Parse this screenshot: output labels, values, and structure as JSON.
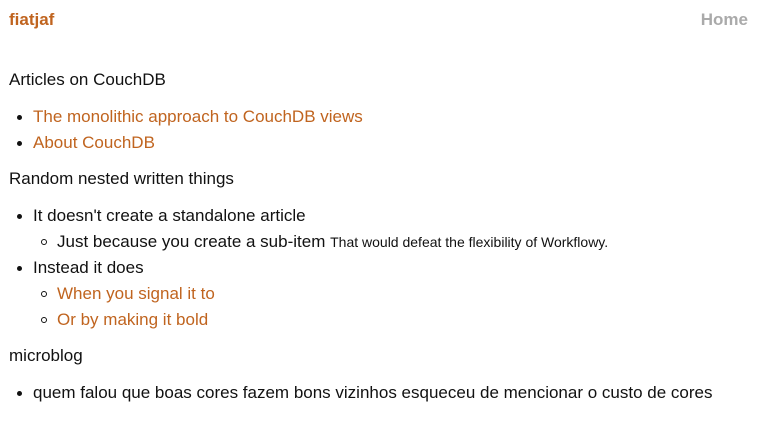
{
  "header": {
    "brand": "fiatjaf",
    "home": "Home"
  },
  "sections": {
    "couchdb": {
      "title": "Articles on CouchDB",
      "items": [
        "The monolithic approach to CouchDB views",
        "About CouchDB"
      ]
    },
    "nested": {
      "title": "Random nested written things",
      "item1": "It doesn't create a standalone article",
      "item1_sub": "Just because you create a sub-item",
      "item1_sub_note": "That would defeat the flexibility of Workflowy.",
      "item2": "Instead it does",
      "item2_subs": [
        "When you signal it to",
        "Or by making it bold"
      ]
    },
    "microblog": {
      "title": "microblog",
      "first_item": "quem falou que boas cores fazem bons vizinhos esqueceu de mencionar o custo de cores"
    }
  },
  "colors": {
    "link": "#c0641f",
    "home": "#aaaaaa",
    "text": "#111111"
  }
}
